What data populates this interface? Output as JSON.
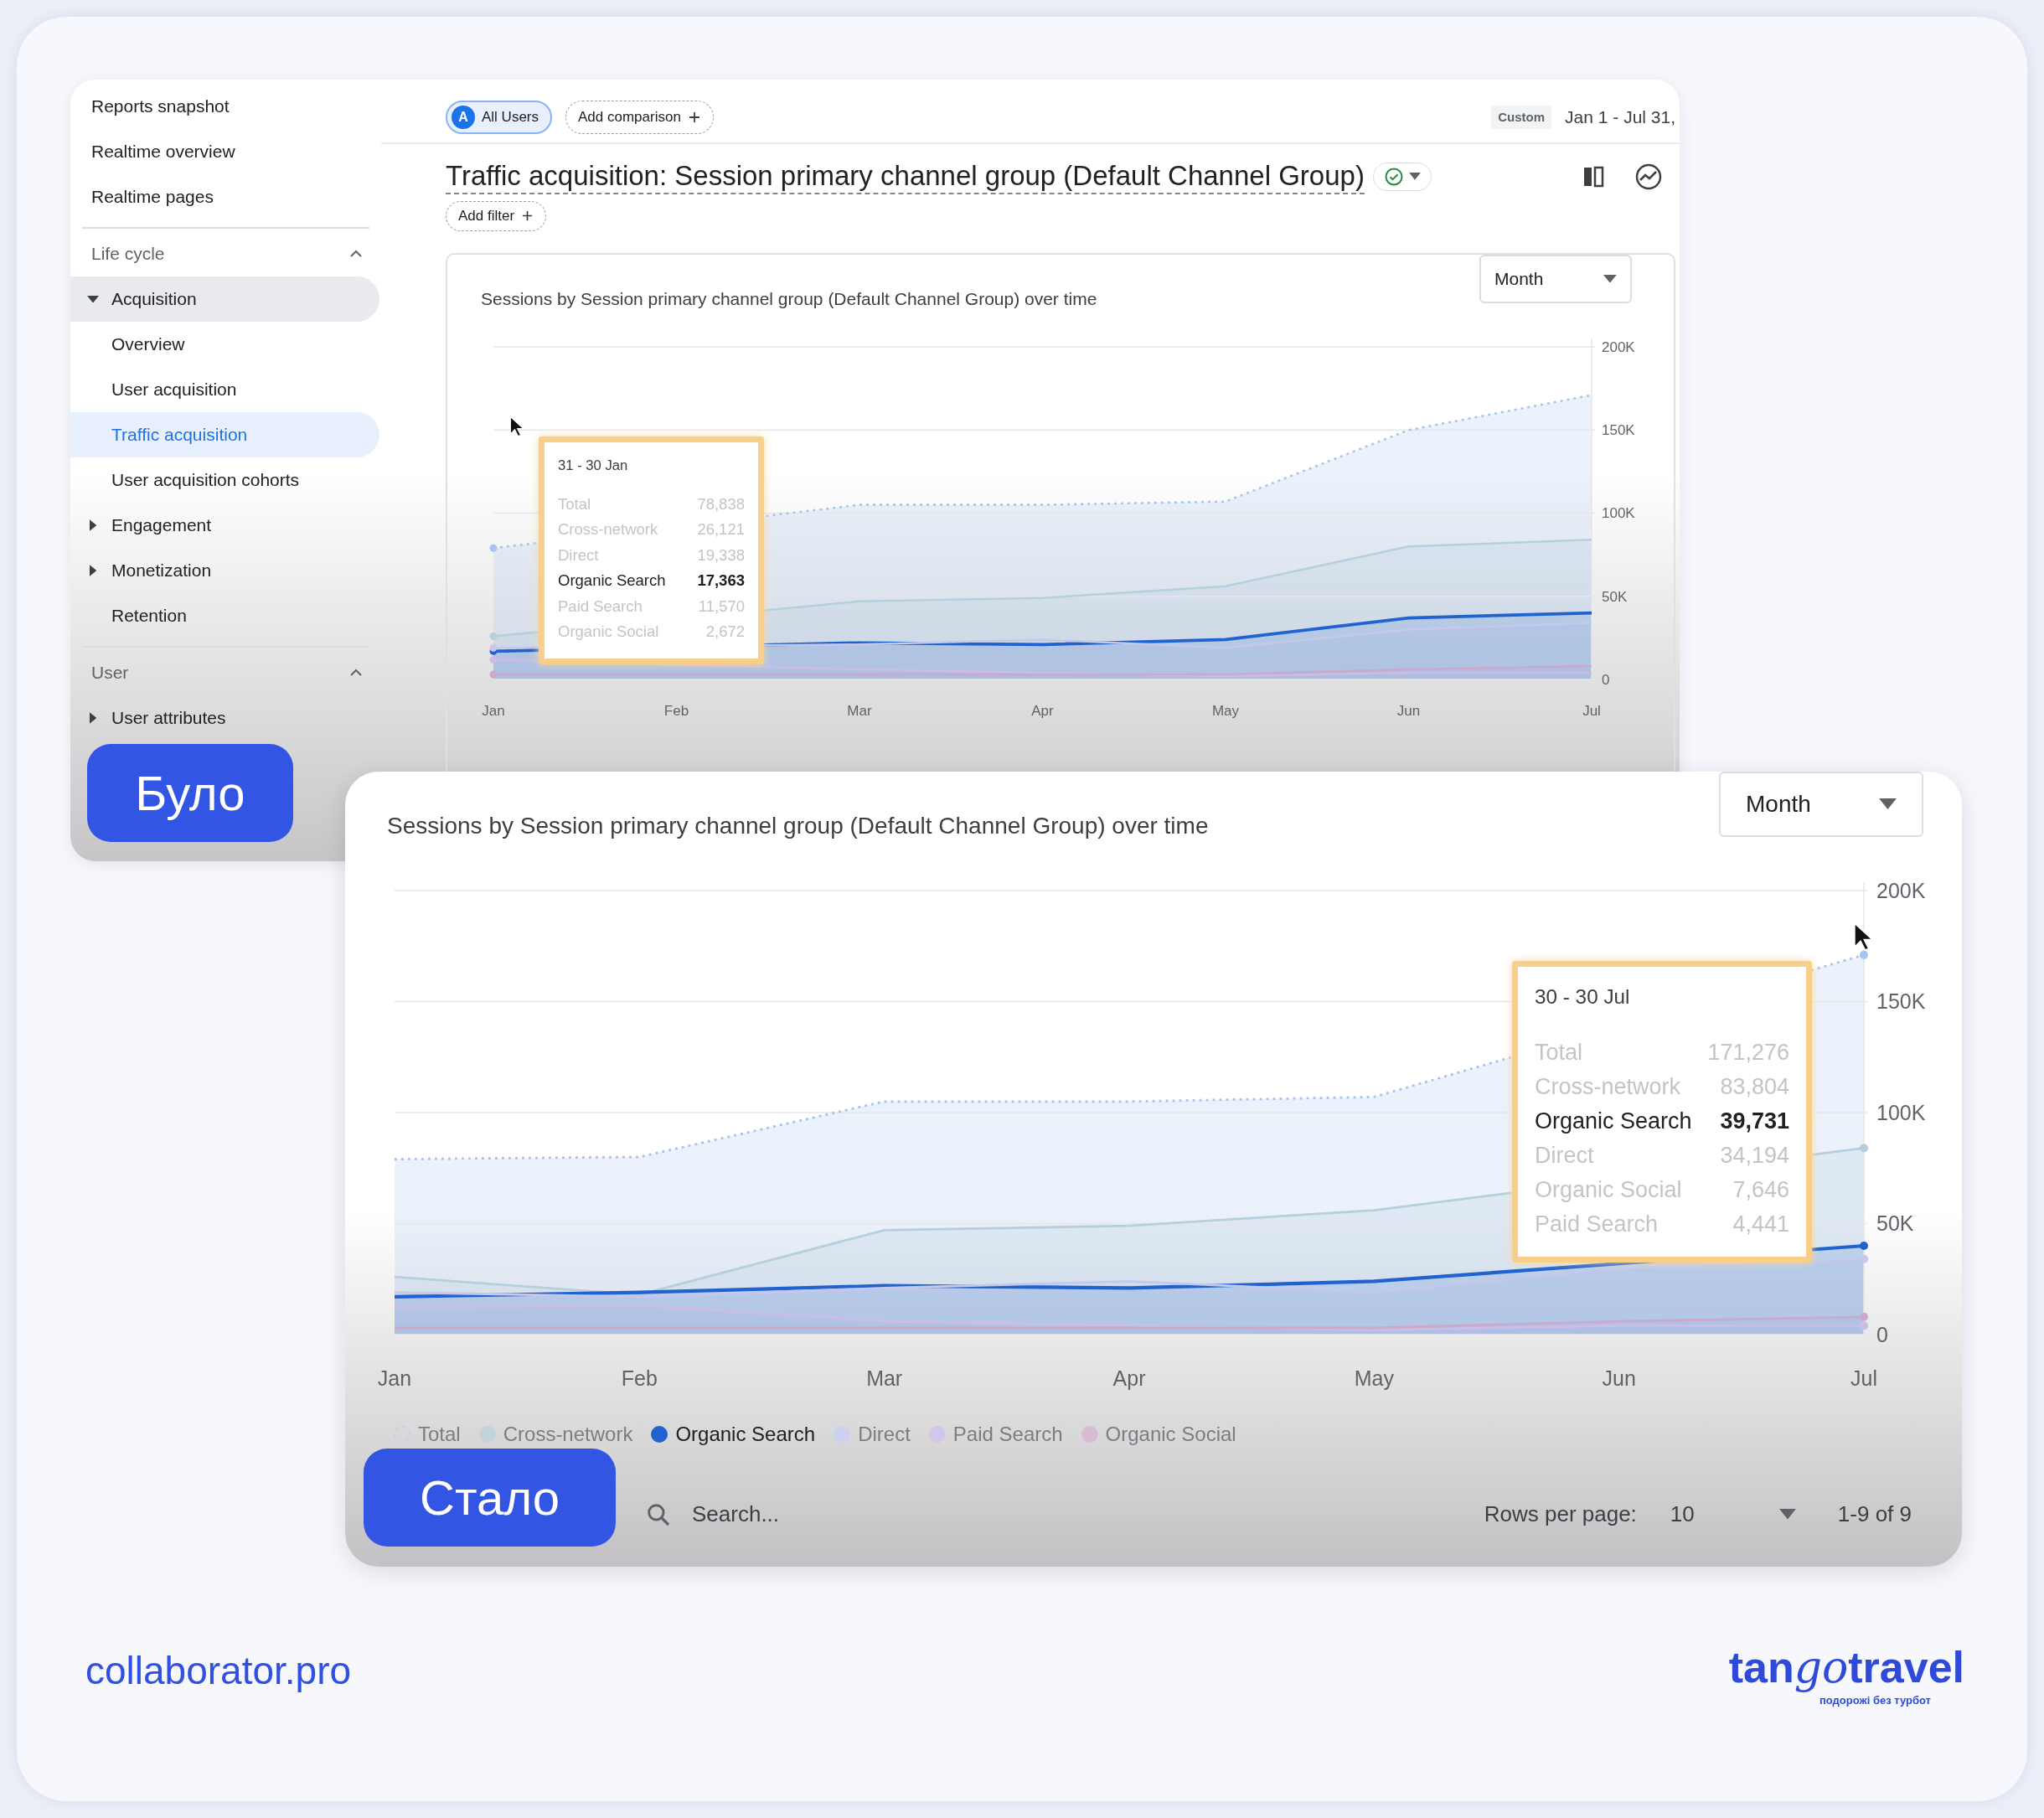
{
  "before_label": "Було",
  "before": {
    "sidebar": [
      {
        "kind": "link",
        "label": "Reports snapshot"
      },
      {
        "kind": "link",
        "label": "Realtime overview"
      },
      {
        "kind": "link",
        "label": "Realtime pages"
      },
      {
        "kind": "section",
        "label": "Life cycle",
        "expanded": true,
        "children": [
          {
            "label": "Acquisition",
            "expanded": true,
            "selected": false,
            "children": [
              {
                "label": "Overview",
                "selected": false
              },
              {
                "label": "User acquisition",
                "selected": false
              },
              {
                "label": "Traffic acquisition",
                "selected": true
              },
              {
                "label": "User acquisition cohorts",
                "selected": false
              }
            ]
          },
          {
            "label": "Engagement",
            "expanded": false,
            "selected": false
          },
          {
            "label": "Monetization",
            "expanded": false,
            "selected": false
          },
          {
            "label": "Retention",
            "selected": false
          }
        ]
      },
      {
        "kind": "section",
        "label": "User",
        "expanded": true,
        "children": [
          {
            "label": "User attributes",
            "expanded": false,
            "selected": false
          }
        ]
      }
    ],
    "comparisons": [
      {
        "kind": "segment",
        "avatar": "A",
        "label": "All Users"
      },
      {
        "kind": "add",
        "label": "Add comparison"
      }
    ],
    "date_badge": "Custom",
    "date_range": "Jan 1 - Jul 31,",
    "title": "Traffic acquisition: Session primary channel group (Default Channel Group)",
    "add_filter": "Add filter",
    "chart_card": {
      "title": "Sessions by Session primary channel group (Default Channel Group) over time",
      "period": "Month",
      "tooltip": {
        "title": "31 - 30 Jan",
        "rows": [
          {
            "label": "Total",
            "value": "78,838",
            "selected": false
          },
          {
            "label": "Cross-network",
            "value": "26,121",
            "selected": false
          },
          {
            "label": "Direct",
            "value": "19,338",
            "selected": false
          },
          {
            "label": "Organic Search",
            "value": "17,363",
            "selected": true
          },
          {
            "label": "Paid Search",
            "value": "11,570",
            "selected": false
          },
          {
            "label": "Organic Social",
            "value": "2,672",
            "selected": false
          }
        ]
      },
      "chart_data": {
        "type": "area",
        "grid": true,
        "categories": [
          "Jan",
          "Feb",
          "Mar",
          "Apr",
          "May",
          "Jun",
          "Jul"
        ],
        "ylim": [
          0,
          200000
        ],
        "yticks": [
          {
            "value": 0,
            "label": "0"
          },
          {
            "value": 50000,
            "label": "50K"
          },
          {
            "value": 100000,
            "label": "100K"
          },
          {
            "value": 150000,
            "label": "150K"
          },
          {
            "value": 200000,
            "label": "200K"
          }
        ],
        "series": [
          {
            "color": "#a8c4ec",
            "line_style": "dotted",
            "values": [
              79000,
              null,
              105000,
              105000,
              107000,
              150000,
              171000
            ]
          },
          {
            "color": "#b5cfdc",
            "values": [
              26000,
              null,
              47000,
              49000,
              56000,
              80000,
              84000
            ]
          },
          {
            "color": "#1f62d0",
            "values": [
              17000,
              null,
              22000,
              21000,
              24000,
              37000,
              40000
            ]
          },
          {
            "color": "#c5c8ec",
            "values": [
              19000,
              null,
              21000,
              24000,
              19000,
              30000,
              34000
            ]
          },
          {
            "color": "#cdbde6",
            "values": [
              12000,
              null,
              6000,
              4000,
              2000,
              4000,
              4000
            ]
          },
          {
            "color": "#c9a9cc",
            "values": [
              3000,
              3000,
              3000,
              3000,
              3000,
              6000,
              8000
            ]
          }
        ]
      }
    }
  },
  "after_label": "Стало",
  "after": {
    "chart_card": {
      "title": "Sessions by Session primary channel group (Default Channel Group) over time",
      "period": "Month",
      "tooltip": {
        "title": "30 - 30 Jul",
        "rows": [
          {
            "label": "Total",
            "value": "171,276",
            "selected": false
          },
          {
            "label": "Cross-network",
            "value": "83,804",
            "selected": false
          },
          {
            "label": "Organic Search",
            "value": "39,731",
            "selected": true
          },
          {
            "label": "Direct",
            "value": "34,194",
            "selected": false
          },
          {
            "label": "Organic Social",
            "value": "7,646",
            "selected": false
          },
          {
            "label": "Paid Search",
            "value": "4,441",
            "selected": false
          }
        ]
      },
      "chart_data": {
        "type": "area",
        "grid": true,
        "categories": [
          "Jan",
          "Feb",
          "Mar",
          "Apr",
          "May",
          "Jun",
          "Jul"
        ],
        "ylim": [
          0,
          200000
        ],
        "yticks": [
          {
            "value": 0,
            "label": "0"
          },
          {
            "value": 50000,
            "label": "50K"
          },
          {
            "value": 100000,
            "label": "100K"
          },
          {
            "value": 150000,
            "label": "150K"
          },
          {
            "value": 200000,
            "label": "200K"
          }
        ],
        "series": [
          {
            "color": "#a8c4ec",
            "line_style": "dotted",
            "values": [
              79000,
              80000,
              105000,
              105000,
              107000,
              null,
              171000
            ]
          },
          {
            "color": "#b5cfdc",
            "values": [
              26000,
              18000,
              47000,
              49000,
              56000,
              null,
              84000
            ]
          },
          {
            "color": "#1f62d0",
            "values": [
              17000,
              19000,
              22000,
              21000,
              24000,
              null,
              40000
            ]
          },
          {
            "color": "#c5c8ec",
            "values": [
              19000,
              17000,
              21000,
              24000,
              19000,
              30000,
              34000
            ]
          },
          {
            "color": "#cdbde6",
            "values": [
              12000,
              13000,
              6000,
              4000,
              2000,
              4000,
              4000
            ]
          },
          {
            "color": "#c9a9cc",
            "values": [
              3000,
              3000,
              3000,
              3000,
              3000,
              6000,
              8000
            ]
          }
        ]
      }
    },
    "legend": [
      {
        "kind": "area",
        "label": "Total",
        "color": "#c3d3ea",
        "selected": false
      },
      {
        "kind": "line",
        "label": "Cross-network",
        "color": "#c2d3dc",
        "selected": false
      },
      {
        "kind": "line",
        "label": "Organic Search",
        "color": "#1f62d0",
        "selected": true
      },
      {
        "kind": "line",
        "label": "Direct",
        "color": "#cdd0ee",
        "selected": false
      },
      {
        "kind": "line",
        "label": "Paid Search",
        "color": "#d3c6ea",
        "selected": false
      },
      {
        "kind": "line",
        "label": "Organic Social",
        "color": "#d6bcd7",
        "selected": false
      }
    ],
    "search": {
      "placeholder": "Search..."
    },
    "rows_per_page_label": "Rows per page:",
    "rows_per_page": "10",
    "pagination": "1-9 of 9"
  },
  "footer": {
    "brand": "collaborator.pro",
    "logo": [
      {
        "kind": "plain",
        "text": "tan"
      },
      {
        "kind": "script",
        "text": "go"
      },
      {
        "kind": "plain",
        "text": "travel"
      }
    ],
    "logo_tagline": "подорожі без турбот"
  }
}
